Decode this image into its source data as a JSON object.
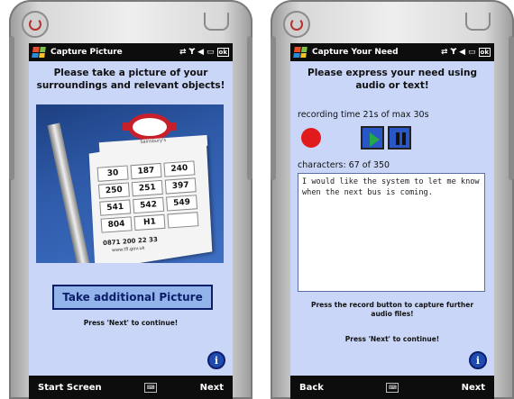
{
  "left": {
    "title": "Capture Picture",
    "heading": "Please take a picture of your surroundings and relevant objects!",
    "sign": {
      "header": "Sainsbury's",
      "routes": [
        "30",
        "187",
        "240",
        "250",
        "251",
        "397",
        "541",
        "542",
        "549",
        "804",
        "H1",
        ""
      ],
      "phone": "0871 200 22 33",
      "url": "www.tfl.gov.uk"
    },
    "take_button": "Take additional Picture",
    "hint": "Press 'Next' to continue!",
    "info_icon": "i",
    "soft_left": "Start Screen",
    "soft_right": "Next"
  },
  "right": {
    "title": "Capture Your Need",
    "heading": "Please express your need using audio or text!",
    "recording_time": "recording time 21s of max 30s",
    "characters": "characters: 67 of 350",
    "text_value": "I would like the system to let me know when the next bus is coming.",
    "hint_record": "Press the record button to capture further audio files!",
    "hint_next": "Press 'Next' to continue!",
    "info_icon": "i",
    "soft_left": "Back",
    "soft_right": "Next"
  },
  "status": {
    "ok_label": "ok"
  },
  "icons": [
    "windows-flag-icon",
    "sync-icon",
    "signal-icon",
    "volume-icon",
    "battery-icon",
    "keyboard-icon",
    "info-icon",
    "record-icon",
    "play-icon",
    "pause-icon",
    "power-icon"
  ]
}
